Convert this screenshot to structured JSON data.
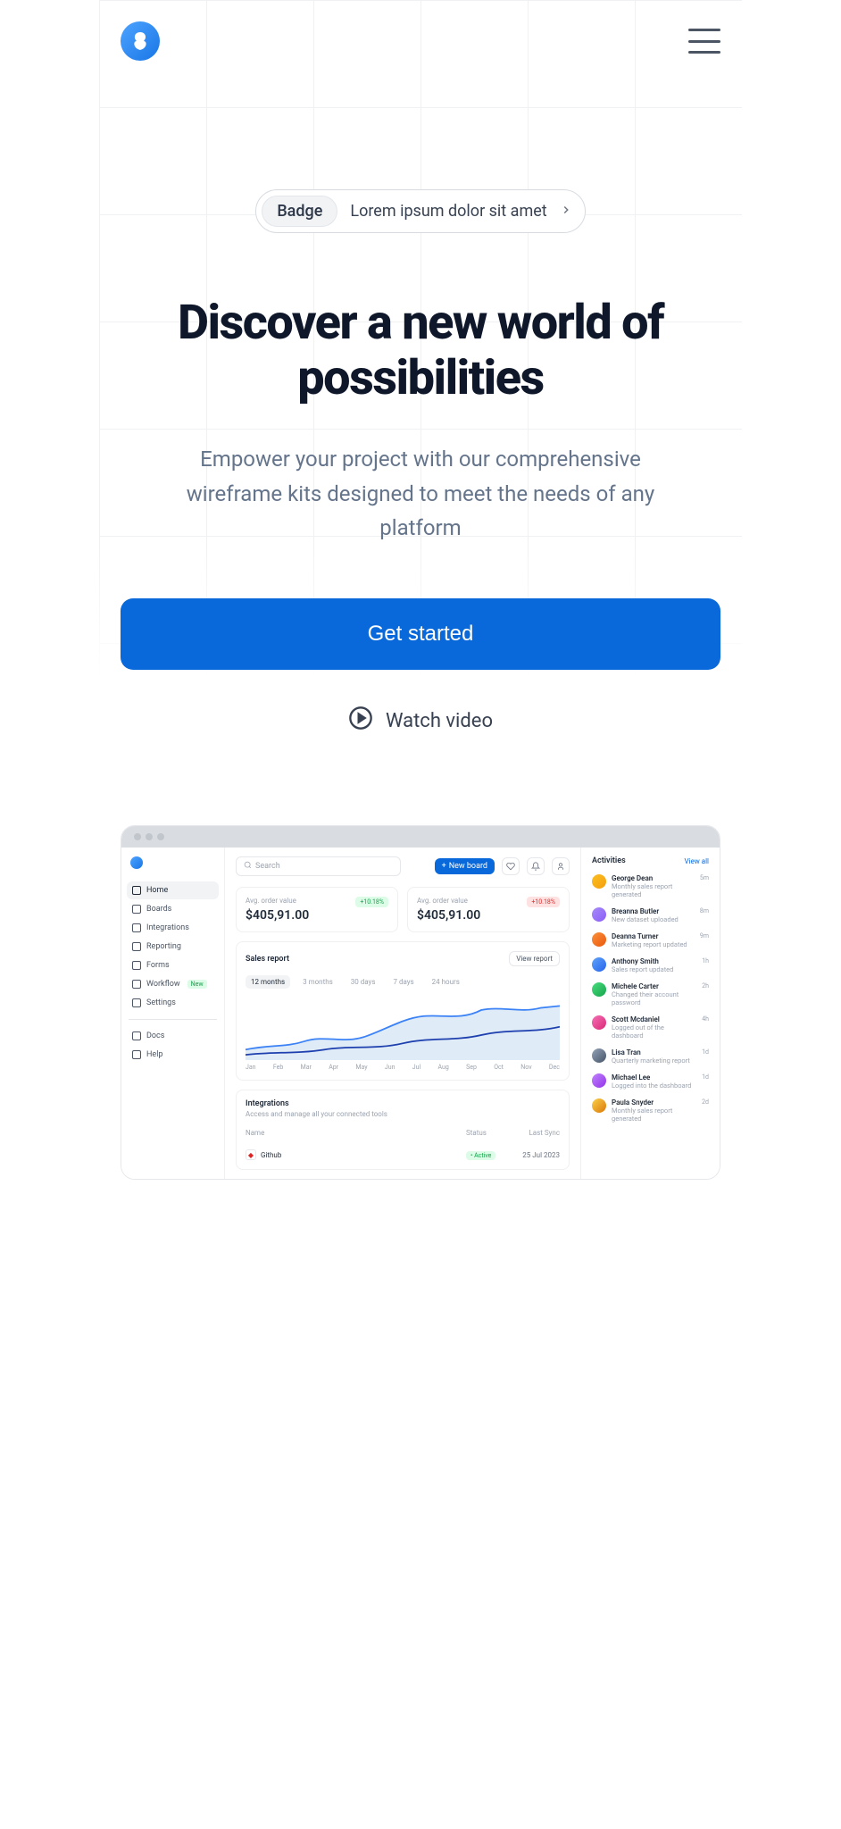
{
  "hero": {
    "badge_label": "Badge",
    "badge_text": "Lorem ipsum dolor sit amet",
    "title": "Discover a new world of possibilities",
    "subtitle": "Empower your project with our comprehensive wireframe kits designed to meet the needs of any platform",
    "cta_primary": "Get started",
    "cta_secondary": "Watch video"
  },
  "dashboard": {
    "search_placeholder": "Search",
    "new_board": "New board",
    "sidebar": {
      "items": [
        {
          "label": "Home"
        },
        {
          "label": "Boards"
        },
        {
          "label": "Integrations"
        },
        {
          "label": "Reporting"
        },
        {
          "label": "Forms"
        },
        {
          "label": "Workflow"
        },
        {
          "label": "Settings"
        }
      ],
      "workflow_badge": "New",
      "footer": [
        {
          "label": "Docs"
        },
        {
          "label": "Help"
        }
      ]
    },
    "cards": [
      {
        "label": "Avg. order value",
        "value": "$405,91.00",
        "pct": "+10.18%"
      },
      {
        "label": "Avg. order value",
        "value": "$405,91.00",
        "pct": "+10.18%"
      }
    ],
    "sales_report": {
      "title": "Sales report",
      "view_btn": "View report",
      "tabs": [
        "12 months",
        "3 months",
        "30 days",
        "7 days",
        "24 hours"
      ],
      "months": [
        "Jan",
        "Feb",
        "Mar",
        "Apr",
        "May",
        "Jun",
        "Jul",
        "Aug",
        "Sep",
        "Oct",
        "Nov",
        "Dec"
      ]
    },
    "integrations": {
      "title": "Integrations",
      "subtitle": "Access and manage all your connected tools",
      "cols": {
        "c1": "Name",
        "c2": "Status",
        "c3": "Last Sync"
      },
      "rows": [
        {
          "name": "Github",
          "status": "Active",
          "last_sync": "25 Jul 2023"
        }
      ]
    },
    "activities": {
      "title": "Activities",
      "view_all": "View all",
      "items": [
        {
          "name": "George Dean",
          "desc": "Monthly sales report generated",
          "time": "5m"
        },
        {
          "name": "Breanna Butler",
          "desc": "New dataset uploaded",
          "time": "8m"
        },
        {
          "name": "Deanna Turner",
          "desc": "Marketing report updated",
          "time": "9m"
        },
        {
          "name": "Anthony Smith",
          "desc": "Sales report updated",
          "time": "1h"
        },
        {
          "name": "Michele Carter",
          "desc": "Changed their account password",
          "time": "2h"
        },
        {
          "name": "Scott Mcdaniel",
          "desc": "Logged out of the dashboard",
          "time": "4h"
        },
        {
          "name": "Lisa Tran",
          "desc": "Quarterly marketing report",
          "time": "1d"
        },
        {
          "name": "Michael Lee",
          "desc": "Logged into the dashboard",
          "time": "1d"
        },
        {
          "name": "Paula Snyder",
          "desc": "Monthly sales report generated",
          "time": "2d"
        }
      ]
    }
  }
}
